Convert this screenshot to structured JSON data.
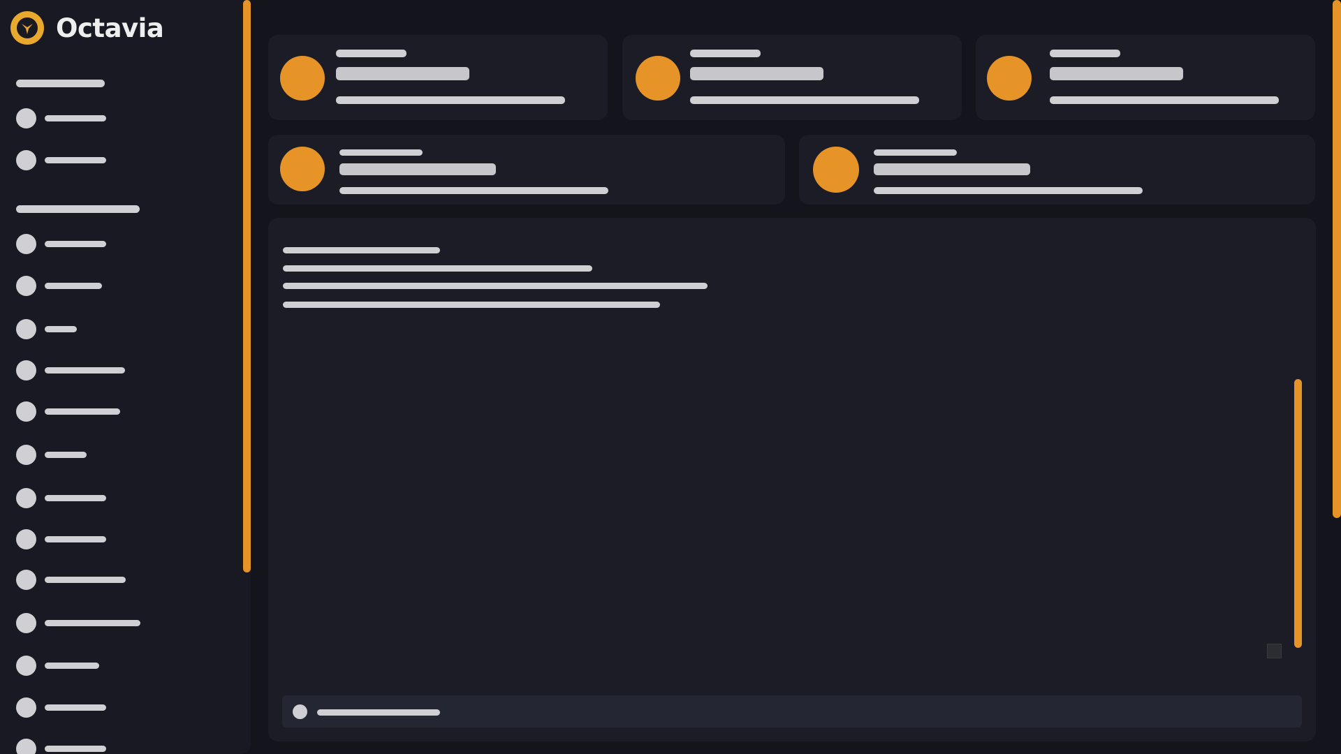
{
  "app": {
    "name": "Octavia"
  },
  "colors": {
    "accent": "#e69428",
    "logo": "#e8a92e",
    "background": "#13141c",
    "surface": "#1b1c26",
    "placeholder": "#cfcfd4"
  },
  "icons": {
    "brand": "octavia-logo-icon",
    "nav_item": "circle-placeholder-icon",
    "card_avatar": "orange-circle-icon"
  },
  "sidebar": {
    "sections": [
      {
        "heading": "",
        "items": [
          "",
          ""
        ]
      },
      {
        "heading": "",
        "items": [
          "",
          "",
          "",
          "",
          "",
          "",
          "",
          "",
          "",
          "",
          "",
          "",
          ""
        ]
      }
    ]
  },
  "cards": [
    "",
    "",
    "",
    "",
    ""
  ],
  "panel": {
    "lines": [
      "",
      "",
      "",
      ""
    ],
    "input_placeholder": ""
  }
}
